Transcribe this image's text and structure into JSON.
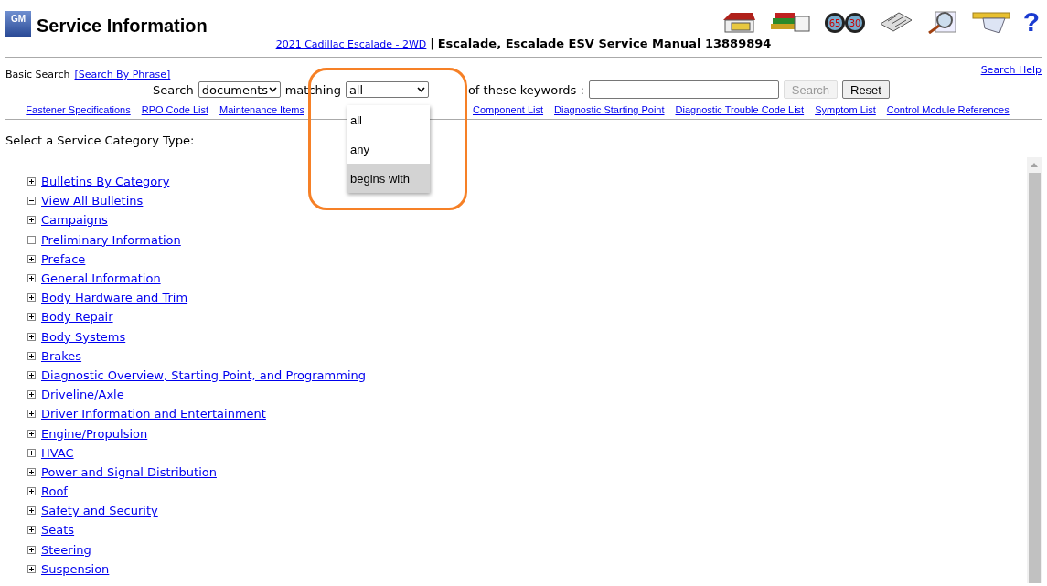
{
  "header": {
    "logo": "GM",
    "title": "Service Information",
    "vehicle_link": "2021 Cadillac Escalade - 2WD",
    "separator": "|",
    "manual_title": "Escalade, Escalade ESV Service Manual 13889894"
  },
  "toolbar": [
    {
      "kind": "home"
    },
    {
      "kind": "books"
    },
    {
      "kind": "binoculars",
      "marks": [
        "65",
        "30"
      ]
    },
    {
      "kind": "newspaper"
    },
    {
      "kind": "magnifier"
    },
    {
      "kind": "envelope"
    },
    {
      "kind": "help",
      "glyph": "?"
    }
  ],
  "search_bar": {
    "mode_label": "Basic Search",
    "phrase_link": "[Search By Phrase]",
    "help_link": "Search Help",
    "search_label": "Search",
    "scope_select": "documents",
    "matching_label": "matching",
    "match_select": "all",
    "keywords_label": "of these keywords :",
    "search_button": {
      "label": "Search",
      "disabled": true
    },
    "reset_button": {
      "label": "Reset",
      "disabled": false
    }
  },
  "quick_links": [
    "Fastener Specifications",
    "RPO Code List",
    "Maintenance Items",
    "Component List",
    "Diagnostic Starting Point",
    "Diagnostic Trouble Code List",
    "Symptom List",
    "Control Module References"
  ],
  "match_dropdown": {
    "options": [
      {
        "label": "all",
        "selected": false
      },
      {
        "label": "any",
        "selected": false
      },
      {
        "label": "begins with",
        "selected": true
      }
    ]
  },
  "category_heading": "Select a Service Category Type:",
  "categories": [
    {
      "label": "Bulletins By Category",
      "expanded": false
    },
    {
      "label": "View All Bulletins",
      "expanded": true
    },
    {
      "label": "Campaigns",
      "expanded": false
    },
    {
      "label": "Preliminary Information",
      "expanded": true
    },
    {
      "label": "Preface",
      "expanded": false
    },
    {
      "label": "General Information",
      "expanded": false
    },
    {
      "label": "Body Hardware and Trim",
      "expanded": false
    },
    {
      "label": "Body Repair",
      "expanded": false
    },
    {
      "label": "Body Systems",
      "expanded": false
    },
    {
      "label": "Brakes",
      "expanded": false
    },
    {
      "label": "Diagnostic Overview, Starting Point, and Programming",
      "expanded": false
    },
    {
      "label": "Driveline/Axle",
      "expanded": false
    },
    {
      "label": "Driver Information and Entertainment",
      "expanded": false
    },
    {
      "label": "Engine/Propulsion",
      "expanded": false
    },
    {
      "label": "HVAC",
      "expanded": false
    },
    {
      "label": "Power and Signal Distribution",
      "expanded": false
    },
    {
      "label": "Roof",
      "expanded": false
    },
    {
      "label": "Safety and Security",
      "expanded": false
    },
    {
      "label": "Seats",
      "expanded": false
    },
    {
      "label": "Steering",
      "expanded": false
    },
    {
      "label": "Suspension",
      "expanded": false
    }
  ]
}
